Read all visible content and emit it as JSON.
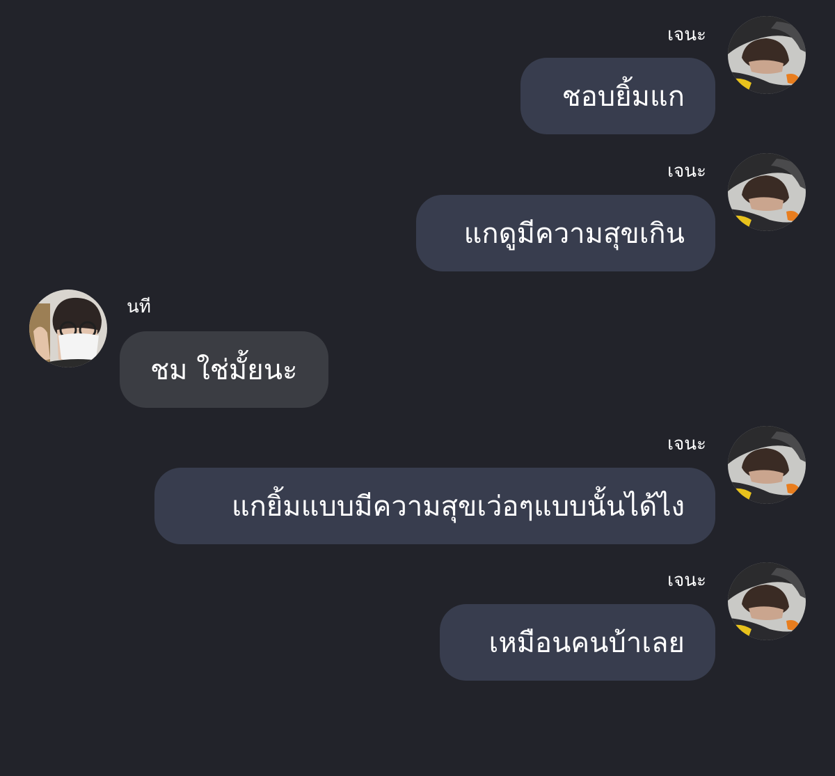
{
  "chat": {
    "messages": [
      {
        "sender": "เจนะ",
        "text": "ชอบยิ้มแก",
        "side": "out",
        "avatar": "jena-avatar"
      },
      {
        "sender": "เจนะ",
        "text": "แกดูมีความสุขเกิน",
        "side": "out",
        "avatar": "jena-avatar"
      },
      {
        "sender": "นที",
        "text": "ชม ใช่มั้ยนะ",
        "side": "in",
        "avatar": "natee-avatar"
      },
      {
        "sender": "เจนะ",
        "text": "แกยิ้มแบบมีความสุขเว่อๆแบบนั้นได้ไง",
        "side": "out",
        "avatar": "jena-avatar"
      },
      {
        "sender": "เจนะ",
        "text": "เหมือนคนบ้าเลย",
        "side": "out",
        "avatar": "jena-avatar"
      }
    ]
  },
  "colors": {
    "background": "#22232a",
    "outgoing_bubble": "#383d4e",
    "incoming_bubble": "#3b3d43",
    "text": "#ffffff"
  }
}
